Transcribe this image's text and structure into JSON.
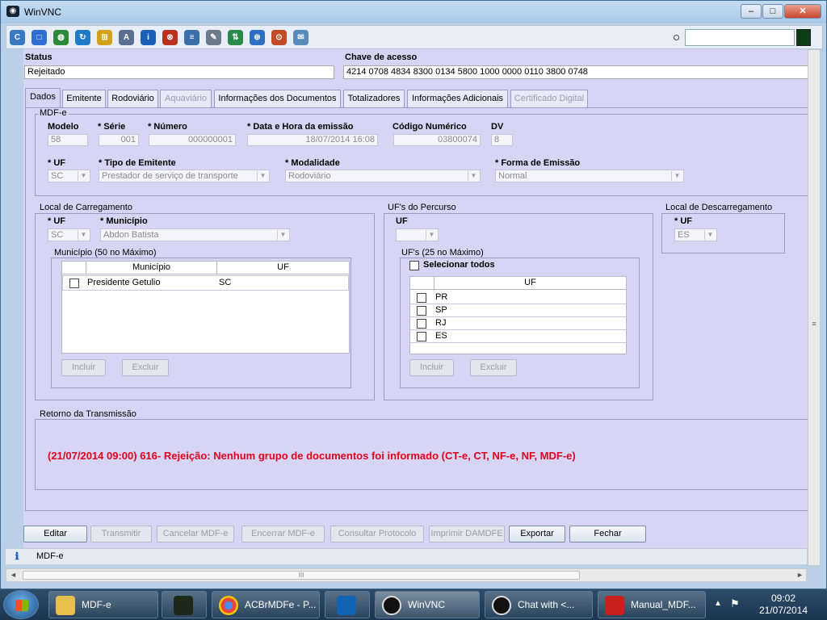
{
  "window": {
    "title": "WinVNC",
    "minimize": "–",
    "maximize": "□",
    "close": "✕"
  },
  "toolbar": {
    "icons": [
      "ctrl-alt-del-icon",
      "fullscreen-icon",
      "globe-icon",
      "refresh-icon",
      "windows-icon",
      "abc-icon",
      "info-icon",
      "close-circle-icon",
      "options-icon",
      "tool-icon",
      "transfer-icon",
      "zoom-icon",
      "target-icon",
      "chat-icon"
    ],
    "search_value": ""
  },
  "header": {
    "status_label": "Status",
    "status_value": "Rejeitado",
    "chave_label": "Chave de acesso",
    "chave_value": "4214 0708 4834 8300 0134 5800 1000 0000 0110 3800 0748"
  },
  "tabs": [
    {
      "label": "Dados"
    },
    {
      "label": "Emitente"
    },
    {
      "label": "Rodoviário"
    },
    {
      "label": "Aquaviário"
    },
    {
      "label": "Informações dos Documentos"
    },
    {
      "label": "Totalizadores"
    },
    {
      "label": "Informações Adicionais"
    },
    {
      "label": "Certificado Digital"
    }
  ],
  "mdfe": {
    "section": "MDF-e",
    "modelo_label": "Modelo",
    "modelo": "58",
    "serie_label": "* Série",
    "serie": "001",
    "numero_label": "* Número",
    "numero": "000000001",
    "data_label": "* Data e Hora da emissão",
    "data": "18/07/2014 16:08",
    "codigo_label": "Código Numérico",
    "codigo": "03800074",
    "dv_label": "DV",
    "dv": "8",
    "uf_label": "* UF",
    "uf": "SC",
    "tipo_label": "* Tipo de Emitente",
    "tipo": "Prestador de serviço de transporte",
    "modalidade_label": "* Modalidade",
    "modalidade": "Rodoviário",
    "forma_label": "* Forma de Emissão",
    "forma": "Normal"
  },
  "carregamento": {
    "section": "Local de Carregamento",
    "uf_label": "* UF",
    "uf": "SC",
    "municipio_label": "* Município",
    "municipio": "Abdon Batista",
    "list_section": "Município (50 no Máximo)",
    "col_municipio": "Município",
    "col_uf": "UF",
    "rows": [
      {
        "municipio": "Presidente Getulio",
        "uf": "SC"
      }
    ],
    "incluir": "Incluir",
    "excluir": "Excluir"
  },
  "percurso": {
    "section": "UF's do Percurso",
    "uf_label": "UF",
    "uf": "",
    "list_section": "UF's (25 no Máximo)",
    "select_all": "Selecionar todos",
    "col_uf": "UF",
    "rows": [
      "PR",
      "SP",
      "RJ",
      "ES"
    ],
    "incluir": "Incluir",
    "excluir": "Excluir"
  },
  "descarregamento": {
    "section": "Local de Descarregamento",
    "uf_label": "* UF",
    "uf": "ES"
  },
  "retorno": {
    "section": "Retorno da Transmissão",
    "message": "(21/07/2014 09:00) 616- Rejeição: Nenhum grupo de documentos foi informado (CT-e, CT, NF-e, NF, MDF-e)",
    "message_color": "#e0001b"
  },
  "buttons": {
    "editar": "Editar",
    "transmitir": "Transmitir",
    "cancelar": "Cancelar MDF-e",
    "encerrar": "Encerrar MDF-e",
    "consultar": "Consultar Protocolo",
    "imprimir": "Imprimir DAMDFE",
    "exportar": "Exportar",
    "fechar": "Fechar"
  },
  "statusbar": {
    "text": "MDF-e"
  },
  "scroll": {
    "h_thumb": "III",
    "v_thumb": "≡"
  },
  "taskbar": {
    "items": [
      {
        "label": "MDF-e"
      },
      {
        "label": ""
      },
      {
        "label": "ACBrMDFe - P..."
      },
      {
        "label": ""
      },
      {
        "label": "WinVNC"
      },
      {
        "label": "Chat with <..."
      },
      {
        "label": "Manual_MDF..."
      }
    ],
    "clock_time": "09:02",
    "clock_date": "21/07/2014"
  }
}
